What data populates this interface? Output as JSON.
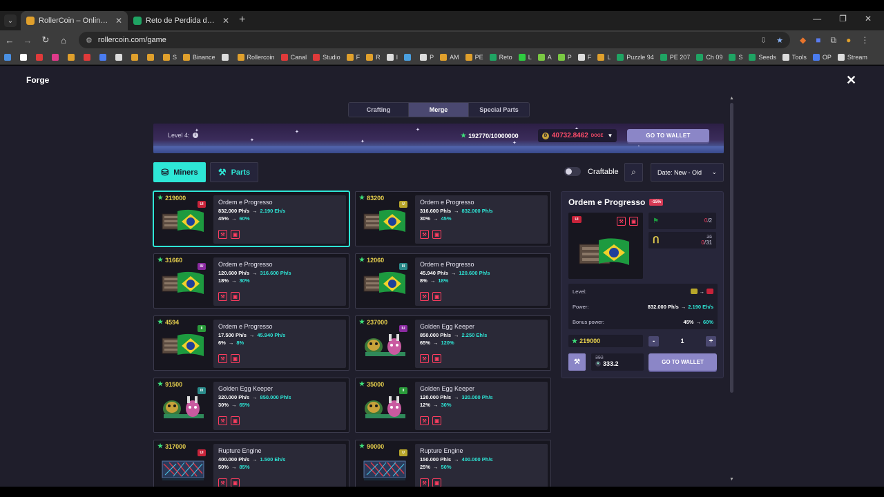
{
  "browser": {
    "tabs": [
      {
        "title": "RollerCoin – Online Bitcoin Mining",
        "active": true
      },
      {
        "title": "Reto de Perdida de Peso - El M",
        "active": false
      }
    ],
    "url": "rollercoin.com/game",
    "bookmarks": [
      "",
      "",
      "",
      "",
      "",
      "",
      "",
      "",
      "",
      "",
      "S",
      "Binance",
      "",
      "Rollercoin",
      "Canal",
      "Studio",
      "F",
      "R",
      "I",
      "",
      "P",
      "AM",
      "PE",
      "Reto",
      "L",
      "A",
      "P",
      "F",
      "L",
      "Puzzle 94",
      "PE 207",
      "Ch 09",
      "S",
      "Seeds",
      "Tools",
      "OP",
      "Stream"
    ]
  },
  "header": {
    "title": "Forge",
    "close_glyph": "✕"
  },
  "tabs": [
    "Crafting",
    "Merge",
    "Special Parts"
  ],
  "banner": {
    "level_label": "Level 4:",
    "xp": "192770/10000000",
    "balance": "40732.8462",
    "balance_unit": "DOGE",
    "wallet_button": "GO TO WALLET"
  },
  "filters": {
    "miners_label": "Miners",
    "parts_label": "Parts",
    "craftable_label": "Craftable",
    "sort_label": "Date: New - Old"
  },
  "cards": [
    {
      "price": "219000",
      "level_color": "#c8233a",
      "level_text": "UI",
      "name": "Ordem e Progresso",
      "p_from": "832.000 Ph/s",
      "p_to": "2.190 Eh/s",
      "b_from": "45%",
      "b_to": "60%",
      "image": "flag",
      "selected": true
    },
    {
      "price": "83200",
      "level_color": "#b8a62a",
      "level_text": "U",
      "name": "Ordem e Progresso",
      "p_from": "316.600 Ph/s",
      "p_to": "832.000 Ph/s",
      "b_from": "30%",
      "b_to": "45%",
      "image": "flag"
    },
    {
      "price": "31660",
      "level_color": "#8a2aa0",
      "level_text": "IU",
      "name": "Ordem e Progresso",
      "p_from": "120.600 Ph/s",
      "p_to": "316.600 Ph/s",
      "b_from": "18%",
      "b_to": "30%",
      "image": "flag"
    },
    {
      "price": "12060",
      "level_color": "#2a8a8a",
      "level_text": "III",
      "name": "Ordem e Progresso",
      "p_from": "45.940 Ph/s",
      "p_to": "120.600 Ph/s",
      "b_from": "8%",
      "b_to": "18%",
      "image": "flag"
    },
    {
      "price": "4594",
      "level_color": "#2a9a3a",
      "level_text": "II",
      "name": "Ordem e Progresso",
      "p_from": "17.500 Ph/s",
      "p_to": "45.940 Ph/s",
      "b_from": "6%",
      "b_to": "8%",
      "image": "flag"
    },
    {
      "price": "237000",
      "level_color": "#8a2aa0",
      "level_text": "IU",
      "name": "Golden Egg Keeper",
      "p_from": "850.000 Ph/s",
      "p_to": "2.250 Eh/s",
      "b_from": "65%",
      "b_to": "120%",
      "image": "egg"
    },
    {
      "price": "91500",
      "level_color": "#2a8a8a",
      "level_text": "III",
      "name": "Golden Egg Keeper",
      "p_from": "320.000 Ph/s",
      "p_to": "850.000 Ph/s",
      "b_from": "30%",
      "b_to": "65%",
      "image": "egg"
    },
    {
      "price": "35000",
      "level_color": "#2a9a3a",
      "level_text": "II",
      "name": "Golden Egg Keeper",
      "p_from": "120.000 Ph/s",
      "p_to": "320.000 Ph/s",
      "b_from": "12%",
      "b_to": "30%",
      "image": "egg"
    },
    {
      "price": "317000",
      "level_color": "#c8233a",
      "level_text": "UI",
      "name": "Rupture Engine",
      "p_from": "400.000 Ph/s",
      "p_to": "1.500 Eh/s",
      "b_from": "50%",
      "b_to": "85%",
      "image": "engine"
    },
    {
      "price": "90000",
      "level_color": "#b8a62a",
      "level_text": "U",
      "name": "Rupture Engine",
      "p_from": "150.000 Ph/s",
      "p_to": "400.000 Ph/s",
      "b_from": "25%",
      "b_to": "50%",
      "image": "engine"
    }
  ],
  "detail": {
    "title": "Ordem e Progresso",
    "discount": "-15%",
    "level_text": "UI",
    "req1": {
      "have": "0",
      "need": "/2"
    },
    "req2": {
      "old": "36",
      "have": "0",
      "need": "/31"
    },
    "level_label": "Level:",
    "level_from_color": "#b8a62a",
    "level_to_color": "#c8233a",
    "power_label": "Power:",
    "power_from": "832.000 Ph/s",
    "power_to": "2.190 Eh/s",
    "bonus_label": "Bonus power:",
    "bonus_from": "45%",
    "bonus_to": "60%",
    "price": "219000",
    "qty": "1",
    "minus": "-",
    "plus": "+",
    "cost_old": "392",
    "cost_new": "333.2",
    "wallet_button": "GO TO WALLET"
  }
}
